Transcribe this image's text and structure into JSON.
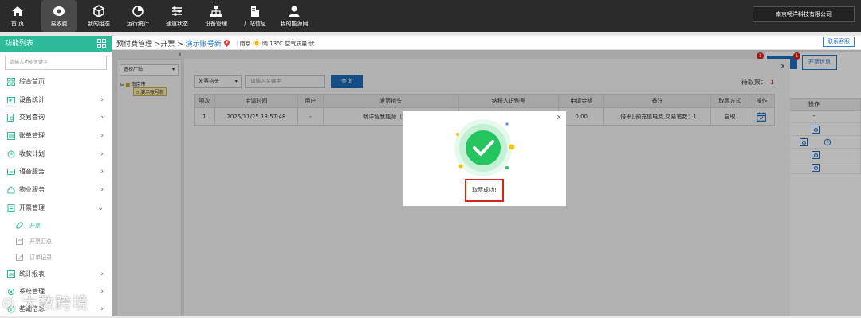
{
  "topnav": [
    {
      "label": "首 页",
      "icon": "home-icon"
    },
    {
      "label": "易收费",
      "icon": "wallet-icon",
      "active": true
    },
    {
      "label": "我的组态",
      "icon": "cube-icon"
    },
    {
      "label": "运行统计",
      "icon": "pie-chart-icon"
    },
    {
      "label": "通道状态",
      "icon": "sliders-icon"
    },
    {
      "label": "设备管理",
      "icon": "network-icon"
    },
    {
      "label": "厂站信息",
      "icon": "building-icon"
    },
    {
      "label": "我的能源网",
      "icon": "user-icon"
    }
  ],
  "company": "南京畅洋科技有限公司",
  "sidebar": {
    "title": "功能列表",
    "search_placeholder": "请输入功能关键字",
    "items": [
      {
        "label": "综合首页",
        "icon": "grid-icon",
        "arrow": ""
      },
      {
        "label": "设备统计",
        "icon": "device-icon",
        "arrow": "›"
      },
      {
        "label": "交易查询",
        "icon": "search-doc-icon",
        "arrow": "›"
      },
      {
        "label": "账单管理",
        "icon": "bill-icon",
        "arrow": "›"
      },
      {
        "label": "收款计划",
        "icon": "plan-icon",
        "arrow": "›"
      },
      {
        "label": "语音服务",
        "icon": "voice-icon",
        "arrow": "›"
      },
      {
        "label": "物业服务",
        "icon": "property-icon",
        "arrow": "›"
      },
      {
        "label": "开票管理",
        "icon": "invoice-icon",
        "arrow": "⌄"
      }
    ],
    "subitems": [
      {
        "label": "开票",
        "icon": "invoice-open-icon",
        "active": true
      },
      {
        "label": "开票汇总",
        "icon": "summary-icon",
        "active": false
      },
      {
        "label": "订单记录",
        "icon": "order-icon",
        "active": false
      }
    ],
    "items2": [
      {
        "label": "统计报表",
        "icon": "report-icon",
        "arrow": "›"
      },
      {
        "label": "系统管理",
        "icon": "system-icon",
        "arrow": "›"
      },
      {
        "label": "基础信息",
        "icon": "info-icon",
        "arrow": "›"
      }
    ]
  },
  "breadcrumb": {
    "path": "预付费管理 >开票 >",
    "location": "演示账号新"
  },
  "weather": {
    "city": "南京",
    "text": "晴 13℃ 空气质量:优"
  },
  "contact_button": "联系客服",
  "tree": {
    "select_label": "选择厂站",
    "root": "南京市",
    "child": "演示账号新"
  },
  "bg_buttons": {
    "btn_invoice": "开票",
    "btn_info": "开票信息",
    "badge1": "1",
    "badge2": "1"
  },
  "bg_table": {
    "header": "操作",
    "row1": "-"
  },
  "modal": {
    "filter_select": "发票抬头",
    "filter_placeholder": "请输入关键字",
    "query_button": "查询",
    "pending_label": "待取票：",
    "pending_count": "1",
    "close": "x",
    "columns": [
      "项次",
      "申请时间",
      "用户",
      "发票抬头",
      "纳税人识别号",
      "申请金额",
      "备注",
      "取票方式",
      "操作"
    ],
    "rows": [
      {
        "index": "1",
        "time": "2025/11/25 13:57:48",
        "user": "-",
        "title": "畅洋智慧能源（南京）",
        "taxid": "",
        "amount": "0.00",
        "remark": "[倍率],预充值电费,交易笔数：1",
        "method": "自取"
      }
    ]
  },
  "popup": {
    "message": "取票成功!",
    "close": "x"
  },
  "watermark": "大数跨境",
  "colors": {
    "accent": "#2dbb9a",
    "primary": "#1f6fc0",
    "danger": "#d9241c",
    "success": "#22c55e"
  }
}
